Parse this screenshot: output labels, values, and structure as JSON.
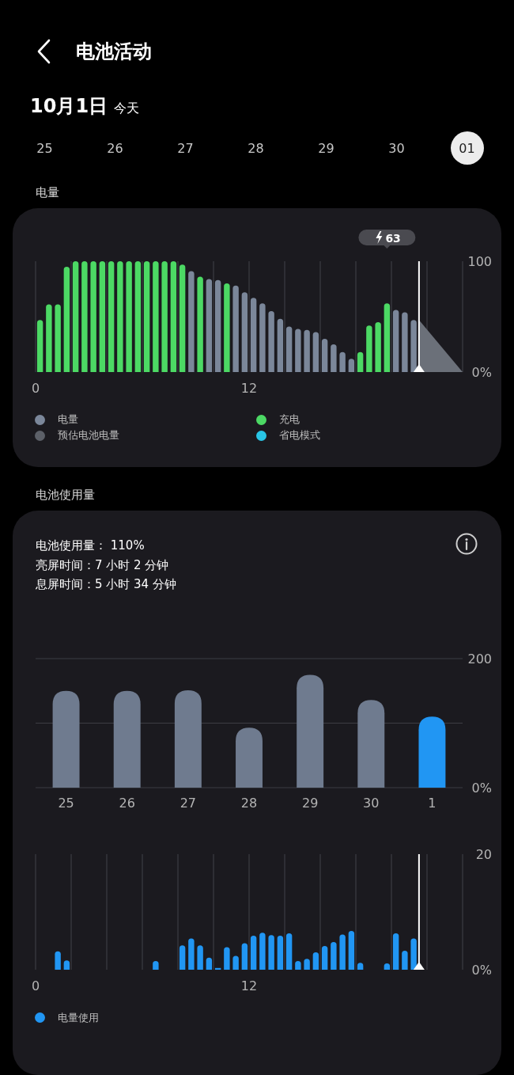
{
  "header": {
    "title": "电池活动"
  },
  "date": {
    "label": "10月1日",
    "relative": "今天"
  },
  "days": [
    {
      "label": "25",
      "selected": false
    },
    {
      "label": "26",
      "selected": false
    },
    {
      "label": "27",
      "selected": false
    },
    {
      "label": "28",
      "selected": false
    },
    {
      "label": "29",
      "selected": false
    },
    {
      "label": "30",
      "selected": false
    },
    {
      "label": "01",
      "selected": true
    }
  ],
  "battery_level": {
    "title": "电量",
    "chart_data": {
      "type": "bar",
      "xlim": [
        0,
        24
      ],
      "ylim": [
        0,
        100
      ],
      "xticks": [
        0,
        12
      ],
      "yticks": [
        {
          "value": 0,
          "label": "0%"
        },
        {
          "value": 100,
          "label": "100"
        }
      ],
      "x": [
        0.25,
        0.75,
        1.25,
        1.75,
        2.25,
        2.75,
        3.25,
        3.75,
        4.25,
        4.75,
        5.25,
        5.75,
        6.25,
        6.75,
        7.25,
        7.75,
        8.25,
        8.75,
        9.25,
        9.75,
        10.25,
        10.75,
        11.25,
        11.75,
        12.25,
        12.75,
        13.25,
        13.75,
        14.25,
        14.75,
        15.25,
        15.75,
        16.25,
        16.75,
        17.25,
        17.75,
        18.25,
        18.75,
        19.25,
        19.75,
        20.25,
        20.75,
        21.25
      ],
      "series": [
        {
          "color": "#7b879a",
          "values": [
            null,
            null,
            null,
            null,
            null,
            null,
            null,
            null,
            null,
            null,
            null,
            null,
            null,
            null,
            null,
            null,
            null,
            91,
            null,
            84,
            83,
            null,
            78,
            72,
            67,
            62,
            55,
            48,
            41,
            39,
            38,
            36,
            30,
            25,
            18,
            12,
            null,
            null,
            null,
            null,
            56,
            54,
            47
          ]
        },
        {
          "color": "#4cd964",
          "values": [
            47,
            61,
            61,
            95,
            100,
            100,
            100,
            100,
            100,
            100,
            100,
            100,
            100,
            100,
            100,
            100,
            97,
            null,
            86,
            null,
            null,
            80,
            null,
            null,
            null,
            null,
            null,
            null,
            null,
            null,
            null,
            null,
            null,
            null,
            null,
            null,
            18,
            42,
            45,
            62,
            null,
            null,
            null
          ]
        }
      ],
      "annotations": [
        "63"
      ]
    },
    "legend": [
      {
        "label": "电量",
        "color": "#7b879a"
      },
      {
        "label": "充电",
        "color": "#4cd964"
      },
      {
        "label": "预估电池电量",
        "color": "#5c6068"
      },
      {
        "label": "省电模式",
        "color": "#29c5e6"
      }
    ]
  },
  "usage": {
    "title": "电池使用量",
    "summary": [
      "电池使用量： 110%",
      "亮屏时间：7 小时 2 分钟",
      "息屏时间：5 小时 34 分钟"
    ],
    "weekly": {
      "chart_data": {
        "type": "bar",
        "categories": [
          "25",
          "26",
          "27",
          "28",
          "29",
          "30",
          "1"
        ],
        "ylim": [
          0,
          200
        ],
        "yticks": [
          {
            "value": 0,
            "label": "0%"
          },
          {
            "value": 200,
            "label": "200"
          }
        ],
        "series": [
          {
            "color": "#6f7b8f",
            "values": [
              150,
              150,
              151,
              93,
              175,
              136,
              null
            ]
          },
          {
            "color": "#2196f3",
            "values": [
              null,
              null,
              null,
              null,
              null,
              null,
              110
            ]
          }
        ]
      }
    },
    "hourly": {
      "chart_data": {
        "type": "bar",
        "xlim": [
          0,
          24
        ],
        "ylim": [
          0,
          20
        ],
        "xticks": [
          0,
          12
        ],
        "yticks": [
          {
            "value": 0,
            "label": "0%"
          },
          {
            "value": 20,
            "label": "20"
          }
        ],
        "x": [
          1.25,
          1.75,
          2.25,
          2.75,
          3.25,
          3.75,
          4.25,
          4.75,
          5.25,
          5.75,
          6.25,
          6.75,
          7.25,
          7.75,
          8.25,
          8.75,
          9.25,
          9.75,
          10.25,
          10.75,
          11.25,
          11.75,
          12.25,
          12.75,
          13.25,
          13.75,
          14.25,
          14.75,
          15.25,
          15.75,
          16.25,
          16.75,
          17.25,
          17.75,
          18.25,
          18.75,
          19.25,
          19.75,
          20.25,
          20.75,
          21.25
        ],
        "series": [
          {
            "color": "#2196f3",
            "values": [
              3.2,
              1.6,
              null,
              null,
              null,
              null,
              null,
              null,
              null,
              null,
              null,
              1.5,
              null,
              null,
              4.2,
              5.4,
              4.2,
              2.1,
              0.3,
              3.9,
              2.4,
              4.6,
              5.9,
              6.4,
              6.0,
              5.9,
              6.3,
              1.5,
              1.9,
              3.0,
              4.1,
              4.8,
              6.1,
              6.7,
              1.2,
              null,
              null,
              1.1,
              6.3,
              3.3,
              5.4
            ]
          }
        ]
      },
      "legend": [
        {
          "label": "电量使用",
          "color": "#2196f3"
        }
      ]
    }
  }
}
